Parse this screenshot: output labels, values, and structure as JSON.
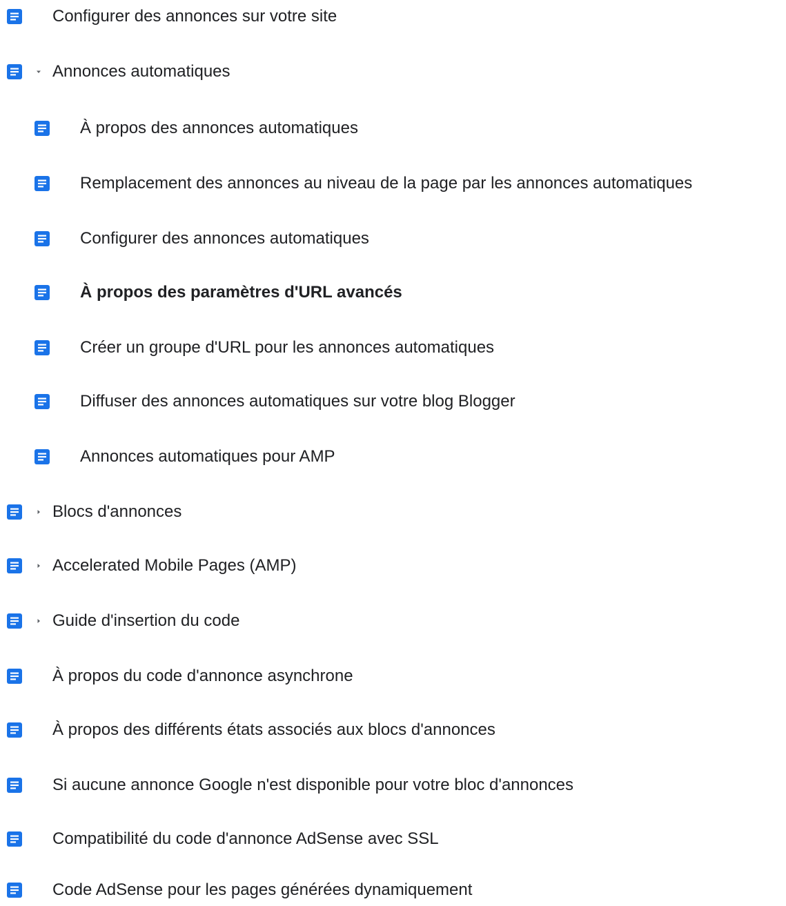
{
  "colors": {
    "icon_blue": "#1a73e8",
    "text": "#202124",
    "arrow": "#5f6368"
  },
  "nav": {
    "items": [
      {
        "label": "Configurer des annonces sur votre site",
        "level": 0,
        "toggle": "none",
        "icon": "document-icon"
      },
      {
        "label": "Annonces automatiques",
        "level": 0,
        "toggle": "expanded",
        "icon": "document-icon"
      },
      {
        "label": "À propos des annonces automatiques",
        "level": 1,
        "toggle": "none",
        "icon": "document-icon"
      },
      {
        "label": "Remplacement des annonces au niveau de la page par les annonces automatiques",
        "level": 1,
        "toggle": "none",
        "icon": "document-icon"
      },
      {
        "label": "Configurer des annonces automatiques",
        "level": 1,
        "toggle": "none",
        "icon": "document-icon"
      },
      {
        "label": "À propos des paramètres d'URL avancés",
        "level": 1,
        "toggle": "none",
        "icon": "document-icon",
        "selected": true
      },
      {
        "label": "Créer un groupe d'URL pour les annonces automatiques",
        "level": 1,
        "toggle": "none",
        "icon": "document-icon"
      },
      {
        "label": "Diffuser des annonces automatiques sur votre blog Blogger",
        "level": 1,
        "toggle": "none",
        "icon": "document-icon"
      },
      {
        "label": "Annonces automatiques pour AMP",
        "level": 1,
        "toggle": "none",
        "icon": "document-icon"
      },
      {
        "label": "Blocs d'annonces",
        "level": 0,
        "toggle": "collapsed",
        "icon": "document-icon"
      },
      {
        "label": "Accelerated Mobile Pages (AMP)",
        "level": 0,
        "toggle": "collapsed",
        "icon": "document-icon"
      },
      {
        "label": "Guide d'insertion du code",
        "level": 0,
        "toggle": "collapsed",
        "icon": "document-icon"
      },
      {
        "label": "À propos du code d'annonce asynchrone",
        "level": 0,
        "toggle": "none",
        "icon": "document-icon"
      },
      {
        "label": "À propos des différents états associés aux blocs d'annonces",
        "level": 0,
        "toggle": "none",
        "icon": "document-icon"
      },
      {
        "label": "Si aucune annonce Google n'est disponible pour votre bloc d'annonces",
        "level": 0,
        "toggle": "none",
        "icon": "document-icon"
      },
      {
        "label": "Compatibilité du code d'annonce AdSense avec SSL",
        "level": 0,
        "toggle": "none",
        "icon": "document-icon"
      },
      {
        "label": "Code AdSense pour les pages générées dynamiquement",
        "level": 0,
        "toggle": "none",
        "icon": "document-icon"
      }
    ]
  }
}
